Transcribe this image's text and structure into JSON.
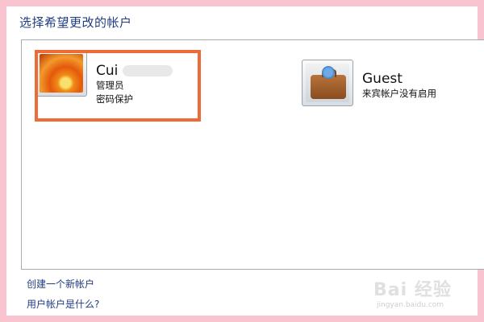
{
  "header": {
    "title": "选择希望更改的帐户"
  },
  "accounts": [
    {
      "name": "Cui",
      "role": "管理员",
      "status": "密码保护",
      "avatar_icon": "flower-icon"
    },
    {
      "name": "Guest",
      "status": "来宾帐户没有启用",
      "avatar_icon": "suitcase-icon"
    }
  ],
  "links": {
    "create": "创建一个新帐户",
    "what_is": "用户帐户是什么?"
  },
  "watermark": {
    "brand": "Bai 经验",
    "site": "jingyan.baidu.com"
  },
  "colors": {
    "background": "#f9c4cf",
    "link": "#1f3d82",
    "highlight": "#ee6a38"
  }
}
